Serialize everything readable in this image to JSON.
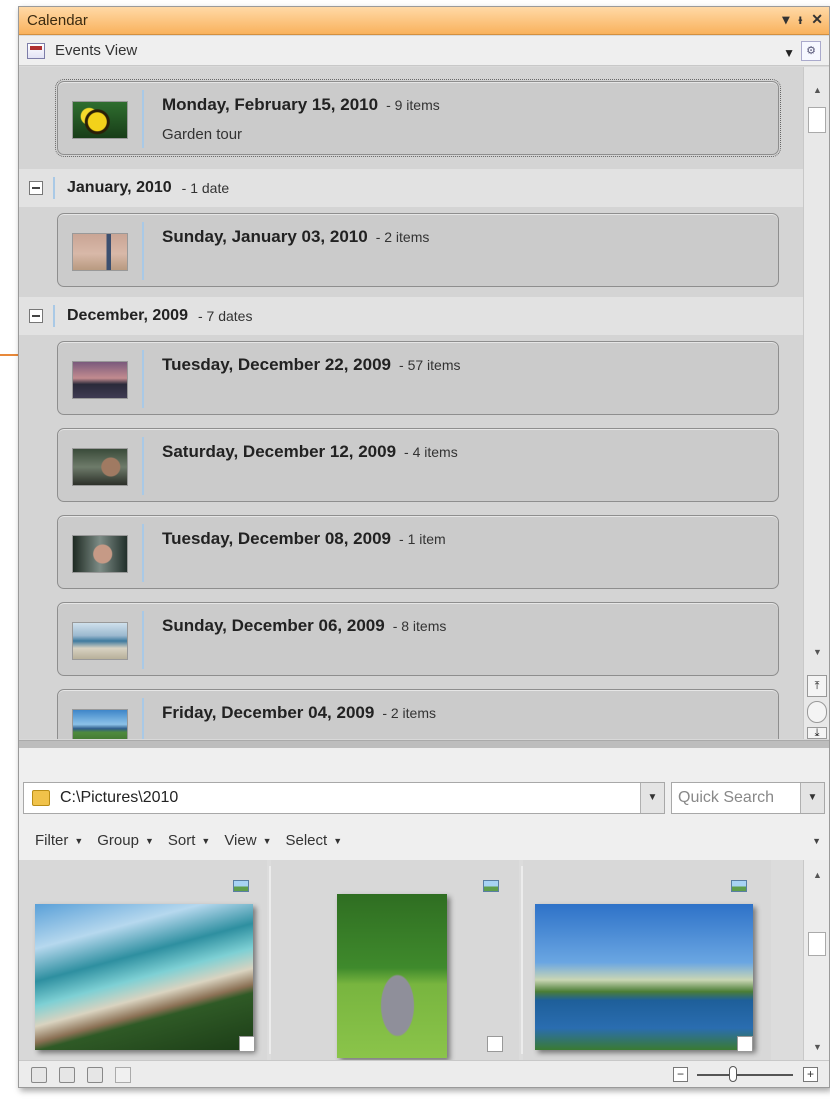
{
  "window": {
    "title": "Calendar"
  },
  "view_selector": {
    "label": "Events View"
  },
  "groups": [
    {
      "title": "January, 2010",
      "count": "- 1 date"
    },
    {
      "title": "December, 2009",
      "count": "- 7 dates"
    }
  ],
  "events": [
    {
      "date": "Monday, February 15, 2010",
      "count": "- 9 items",
      "subtitle": "Garden tour"
    },
    {
      "date": "Sunday, January 03, 2010",
      "count": "- 2 items"
    },
    {
      "date": "Tuesday, December 22, 2009",
      "count": "- 57 items"
    },
    {
      "date": "Saturday, December 12, 2009",
      "count": "- 4 items"
    },
    {
      "date": "Tuesday, December 08, 2009",
      "count": "- 1 item"
    },
    {
      "date": "Sunday, December 06, 2009",
      "count": "- 8 items"
    },
    {
      "date": "Friday, December 04, 2009",
      "count": "- 2 items"
    }
  ],
  "browser": {
    "path": "C:\\Pictures\\2010",
    "search_placeholder": "Quick Search",
    "menu": [
      "Filter",
      "Group",
      "Sort",
      "View",
      "Select"
    ]
  },
  "icons": {
    "titlebar": [
      "dropdown-arrow-icon",
      "pin-icon",
      "close-icon"
    ],
    "scroll_nav": [
      "scroll-top-icon",
      "scroll-center-icon",
      "scroll-bottom-icon"
    ],
    "status": [
      "rotate-left-icon",
      "rotate-cw-icon",
      "rotate-ccw-icon",
      "layout-icon"
    ]
  },
  "colors": {
    "titlebar": "#f9b25d",
    "callout": "#e8893a",
    "accent_divider": "#a9c9e6"
  }
}
